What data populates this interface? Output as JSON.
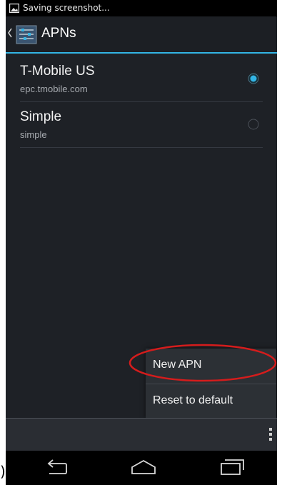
{
  "status_bar": {
    "notification_text": "Saving screenshot...",
    "notification_icon": "screenshot-icon"
  },
  "action_bar": {
    "title": "APNs",
    "up_icon": "chevron-left-icon",
    "app_icon": "settings-sliders-icon",
    "divider_color": "#33b5e5"
  },
  "apns": [
    {
      "name": "T-Mobile US",
      "apn": "epc.tmobile.com",
      "selected": true
    },
    {
      "name": "Simple",
      "apn": "simple",
      "selected": false
    }
  ],
  "overflow_menu": {
    "items": [
      {
        "label": "New APN",
        "highlighted": true
      },
      {
        "label": "Reset to default"
      }
    ],
    "highlight_color": "#d51c1c"
  },
  "bottom_bar": {
    "overflow_icon": "overflow-dots-icon"
  },
  "nav_bar": {
    "buttons": [
      "back-icon",
      "home-icon",
      "recents-icon"
    ]
  },
  "edge_glyph": ")"
}
